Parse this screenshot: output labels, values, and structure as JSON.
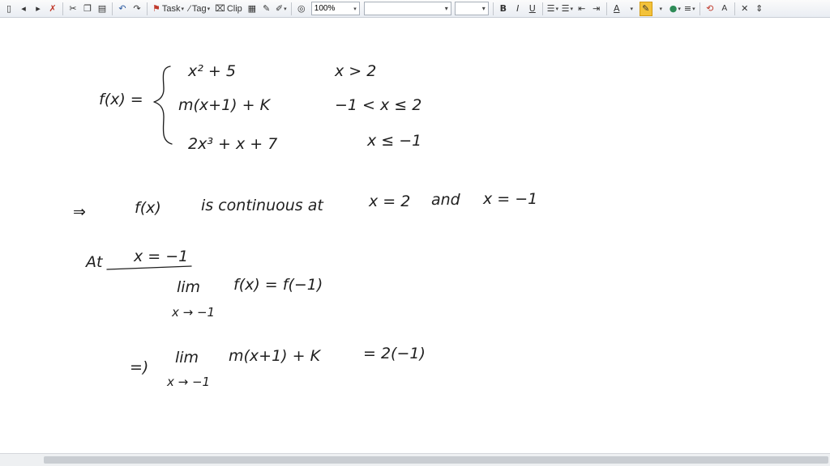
{
  "toolbar": {
    "task_label": "Task",
    "tag_label": "Tag",
    "clip_label": "Clip",
    "zoom_value": "100%",
    "bold": "B",
    "italic": "I",
    "underline": "U",
    "font_color_glyph": "A",
    "font_size_glyph": "A"
  },
  "note": {
    "f_label": "f(x) =",
    "case1_expr": "x² + 5",
    "case1_cond": "x > 2",
    "case2_expr": "m(x+1) + K",
    "case2_cond": "−1 < x ≤ 2",
    "case3_expr": "2x³ + x + 7",
    "case3_cond": "x ≤ −1",
    "implies1": "⇒",
    "line_fx": "f(x)",
    "line_continuous": "is continuous at",
    "line_x2": "x = 2",
    "line_and": "and",
    "line_xm1": "x = −1",
    "at_label": "At",
    "at_value": "x = −1",
    "lim1_word": "lim",
    "lim1_sub": "x → −1",
    "lim1_rhs": "f(x) = f(−1)",
    "implies2": "=)",
    "lim2_word": "lim",
    "lim2_sub": "x → −1",
    "lim2_rhs": "m(x+1) + K",
    "lim2_eq": "= 2(−1)"
  }
}
